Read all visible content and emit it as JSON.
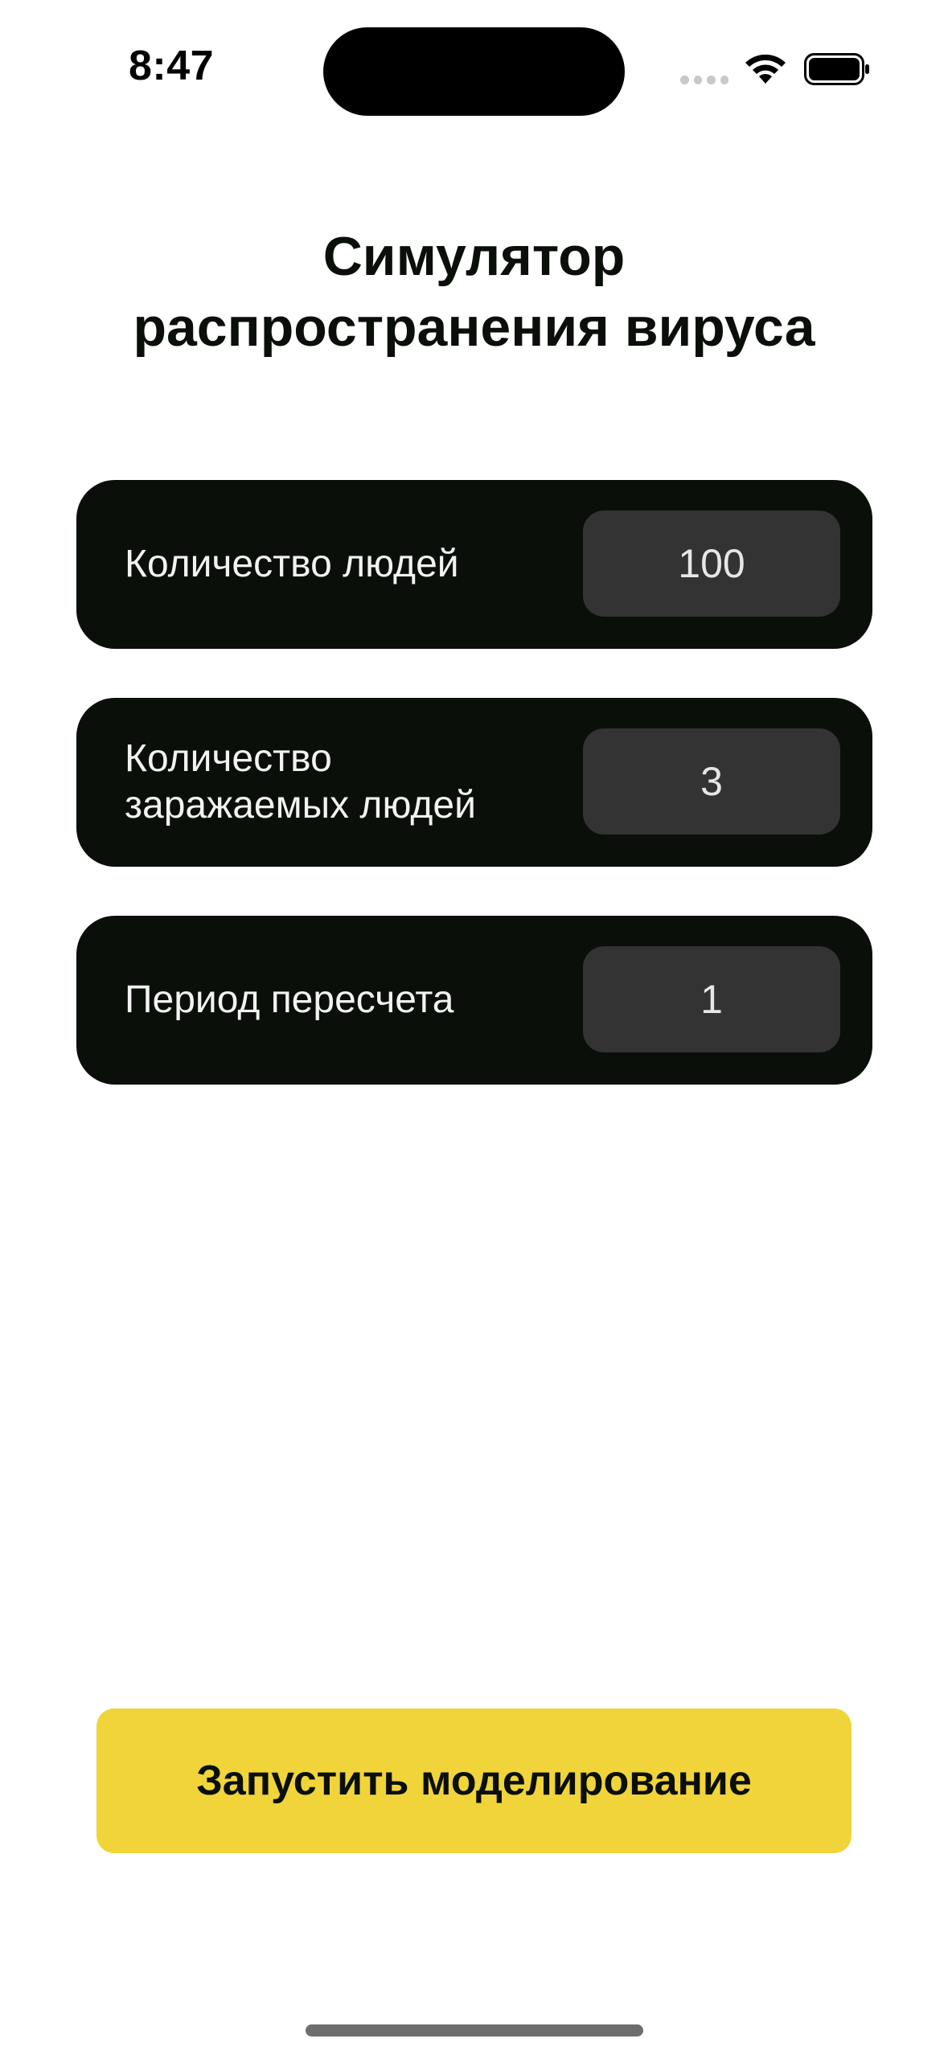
{
  "status_bar": {
    "time": "8:47",
    "wifi_icon": "wifi-icon",
    "battery_icon": "battery-full-icon",
    "signal_icon": "cellular-signal-icon"
  },
  "header": {
    "title_line1": "Симулятор",
    "title_line2": "распространения вируса"
  },
  "params": [
    {
      "label": "Количество людей",
      "value": "100"
    },
    {
      "label": "Количество\nзаражаемых людей",
      "value": "3"
    },
    {
      "label": "Период пересчета",
      "value": "1"
    }
  ],
  "actions": {
    "start_label": "Запустить моделирование"
  },
  "colors": {
    "card_background": "#0a0f0a",
    "input_background": "#333333",
    "accent": "#f0d43a",
    "page_background": "#ffffff"
  }
}
